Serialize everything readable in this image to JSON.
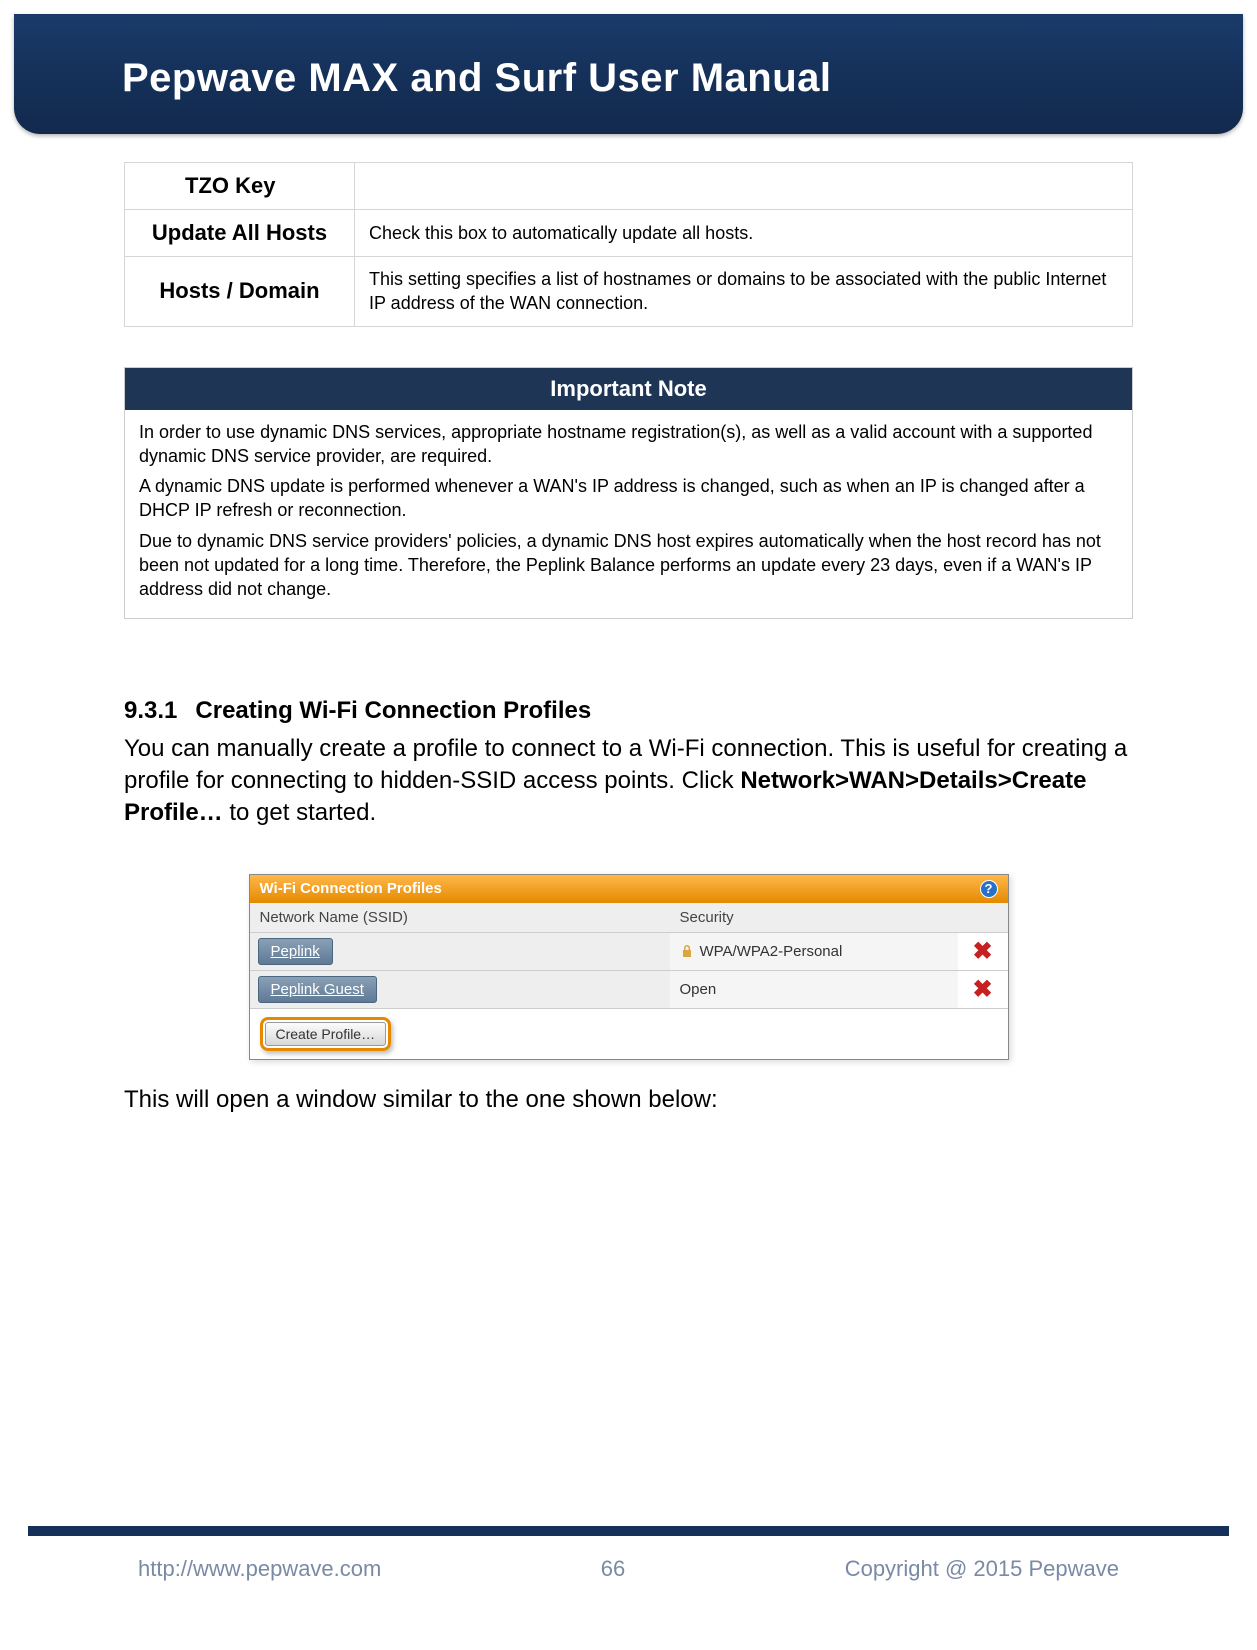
{
  "header": {
    "title": "Pepwave MAX and Surf User Manual"
  },
  "settings_rows": {
    "r0_label": "TZO Key",
    "r1_label": "Update All Hosts",
    "r1_desc": "Check this box to automatically update all hosts.",
    "r2_label": "Hosts / Domain",
    "r2_desc": "This setting specifies a list of hostnames or domains to be associated with the public Internet IP address of the WAN connection."
  },
  "note": {
    "title": "Important Note",
    "p1": "In order to use dynamic DNS services, appropriate hostname registration(s), as well as a valid account with a supported dynamic DNS service provider, are required.",
    "p2": "A dynamic DNS update is performed whenever a WAN's IP address is changed, such as when an IP is changed after a DHCP IP refresh or reconnection.",
    "p3": "Due to dynamic DNS service providers' policies, a dynamic DNS host expires automatically when the host record has not been not updated for a long time. Therefore, the Peplink Balance performs an update every 23 days, even if a WAN's IP address did not change."
  },
  "section": {
    "number": "9.3.1",
    "title": "Creating Wi-Fi Connection Profiles",
    "intro_a": "You can manually create a profile to connect to a Wi-Fi connection. This is useful for creating a profile for connecting to hidden-SSID access points. Click ",
    "intro_bold": "Network>WAN>Details>Create Profile…",
    "intro_b": " to get started.",
    "after": "This will open a window similar to the one shown below:"
  },
  "wifi_panel": {
    "title": "Wi-Fi Connection Profiles",
    "col_name": "Network Name (SSID)",
    "col_sec": "Security",
    "rows": [
      {
        "name": "Peplink",
        "security": "WPA/WPA2-Personal",
        "locked": true
      },
      {
        "name": "Peplink Guest",
        "security": "Open",
        "locked": false
      }
    ],
    "create_label": "Create Profile…",
    "help_glyph": "?"
  },
  "footer": {
    "url": "http://www.pepwave.com",
    "page": "66",
    "copyright": "Copyright @ 2015 Pepwave"
  }
}
